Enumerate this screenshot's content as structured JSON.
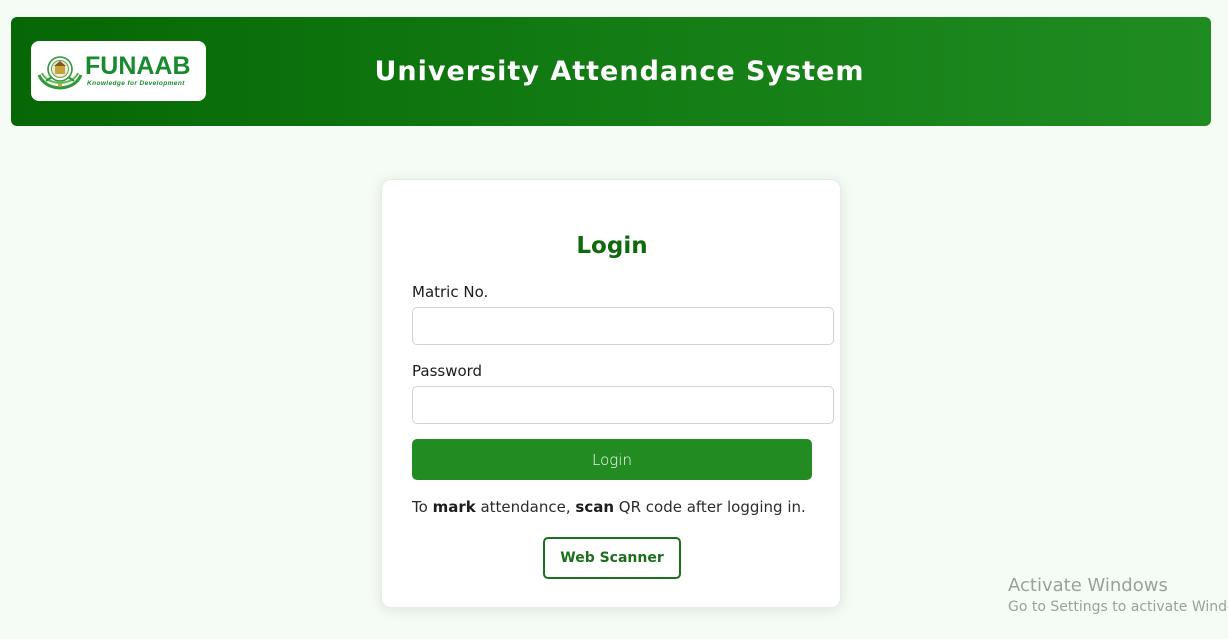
{
  "header": {
    "logo": {
      "name": "FUNAAB",
      "tagline": "Knowledge for Development"
    },
    "title": "University Attendance System"
  },
  "login": {
    "title": "Login",
    "matric_label": "Matric No.",
    "matric_value": "",
    "password_label": "Password",
    "password_value": "",
    "submit_label": "Login",
    "hint": {
      "p1": "To ",
      "b1": "mark",
      "p2": " attendance, ",
      "b2": "scan",
      "p3": " QR code after logging in."
    },
    "scanner_label": "Web Scanner"
  },
  "watermark": {
    "title": "Activate Windows",
    "subtitle": "Go to Settings to activate Windows."
  },
  "colors": {
    "header_start": "#056705",
    "header_end": "#1f8c22",
    "accent": "#228b22",
    "title_green": "#0d6a0d"
  }
}
